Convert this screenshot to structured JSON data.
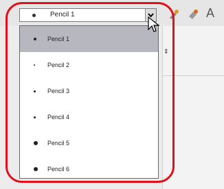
{
  "combo": {
    "value": "Pencil 1"
  },
  "toolbar": {
    "letter": "A"
  },
  "dropdown": {
    "items": [
      {
        "label": "Pencil 1",
        "marker_size": 4
      },
      {
        "label": "Pencil 2",
        "marker_size": 2
      },
      {
        "label": "Pencil 3",
        "marker_size": 3
      },
      {
        "label": "Pencil 4",
        "marker_size": 3
      },
      {
        "label": "Pencil 5",
        "marker_size": 6
      },
      {
        "label": "Pencil 6",
        "marker_size": 6
      }
    ],
    "selected_index": 0
  },
  "colors": {
    "highlight": "#e0101a",
    "selected": "#b7b7bf"
  }
}
